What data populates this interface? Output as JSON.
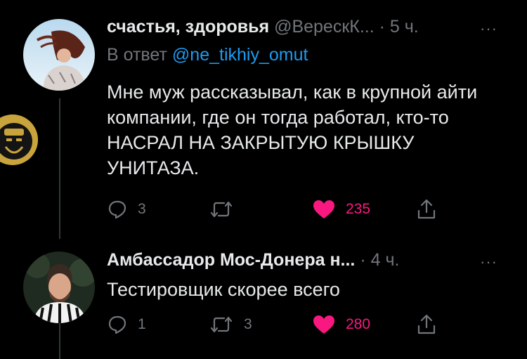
{
  "tweets": [
    {
      "name": "счастья, здоровья",
      "handle": "@ВерескК...",
      "dot": "·",
      "time": "5 ч.",
      "more": "···",
      "reply_prefix": "В ответ",
      "reply_mention": "@ne_tikhiy_omut",
      "text": "Мне муж рассказывал, как в крупной айти компании, где он тогда работал, кто-то НАСРАЛ НА ЗАКРЫТУЮ КРЫШКУ УНИТАЗА.",
      "replies": "3",
      "retweets": "",
      "likes": "235"
    },
    {
      "name": "Амбассадор Мос-Донера н...",
      "dot": "·",
      "time": "4 ч.",
      "more": "···",
      "text": "Тестировщик скорее всего",
      "replies": "1",
      "retweets": "3",
      "likes": "280"
    }
  ],
  "icons": {
    "reply": "speech-bubble-icon",
    "retweet": "retweet-arrows-icon",
    "like": "heart-icon",
    "share": "share-upload-icon"
  },
  "colors": {
    "background": "#000000",
    "text": "#e7e9ea",
    "muted": "#71767b",
    "link": "#1d9bf0",
    "like": "#f91880",
    "thread_line": "#333639"
  }
}
